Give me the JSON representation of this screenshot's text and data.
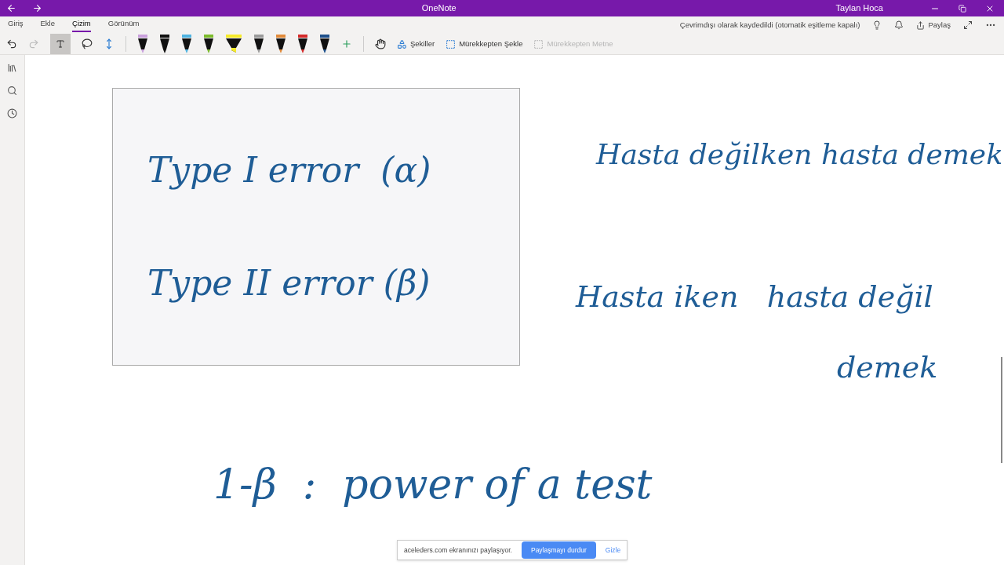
{
  "window": {
    "title": "OneNote",
    "user": "Taylan Hoca"
  },
  "tabs": [
    {
      "label": "Giriş",
      "selected": false
    },
    {
      "label": "Ekle",
      "selected": false
    },
    {
      "label": "Çizim",
      "selected": true
    },
    {
      "label": "Görünüm",
      "selected": false
    }
  ],
  "status": "Çevrimdışı olarak kaydedildi (otomatik eşitleme kapalı)",
  "share_label": "Paylaş",
  "pens": [
    {
      "kind": "pen",
      "color": "#c9a0dc"
    },
    {
      "kind": "pen",
      "color": "#111111"
    },
    {
      "kind": "pen",
      "color": "#4fb3e0"
    },
    {
      "kind": "pen",
      "color": "#7cbb2c"
    },
    {
      "kind": "highlighter",
      "color": "#f5ea2a"
    },
    {
      "kind": "pen",
      "color": "#9a9a9a"
    },
    {
      "kind": "pen",
      "color": "#e08a3a"
    },
    {
      "kind": "pen",
      "color": "#d42a2a"
    },
    {
      "kind": "pen",
      "color": "#1d4f8a"
    }
  ],
  "tools": [
    {
      "label": "Şekiller",
      "disabled": false
    },
    {
      "label": "Mürekkepten Şekle",
      "disabled": false
    },
    {
      "label": "Mürekkepten Metne",
      "disabled": true
    }
  ],
  "ink": {
    "box_lines": [
      "Type I error  (α)",
      "Type II error (β)"
    ],
    "right_lines": [
      "Hasta değilken hasta demek",
      "Hasta iken   hasta değil",
      "demek"
    ],
    "bottom_line": "1-β  :  power of a test"
  },
  "share_bar": {
    "message": "aceleders.com ekranınızı paylaşıyor.",
    "stop_button": "Paylaşmayı durdur",
    "hide_link": "Gizle"
  }
}
